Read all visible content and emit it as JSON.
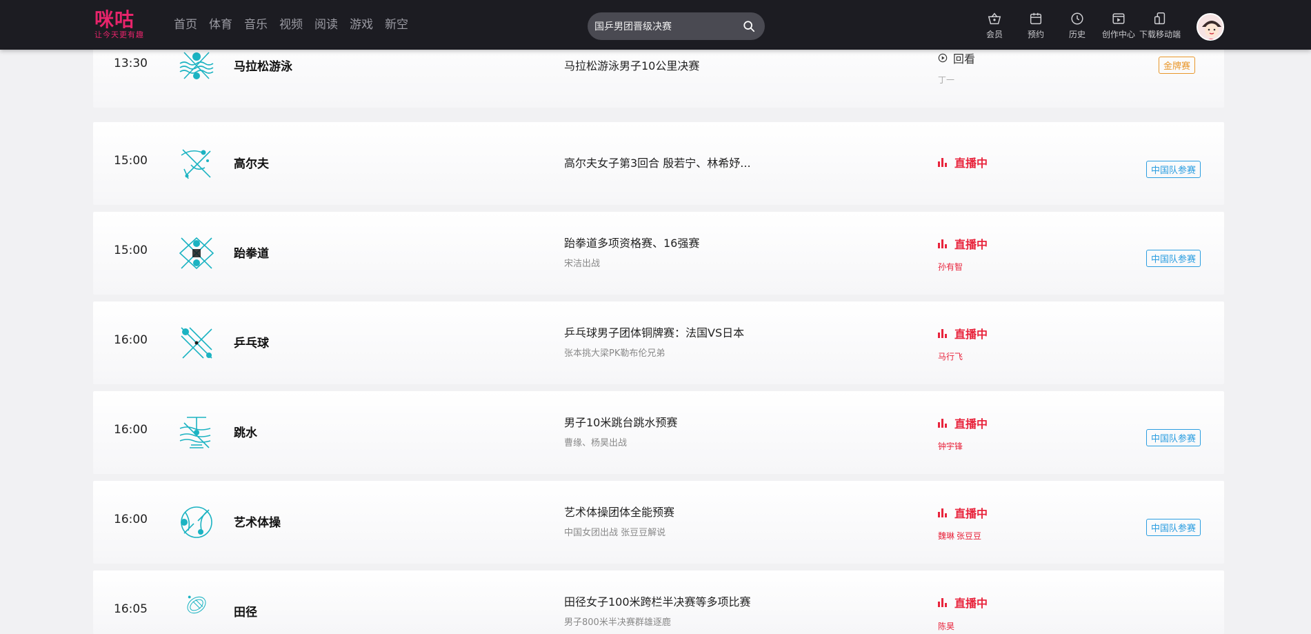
{
  "header": {
    "logo_main": "咪咕",
    "logo_sub": "让今天更有趣",
    "nav": [
      "首页",
      "体育",
      "音乐",
      "视频",
      "阅读",
      "游戏",
      "新空"
    ],
    "search_value": "国乒男团晋级决赛",
    "tools": [
      {
        "label": "会员",
        "icon": "vip-basket-icon"
      },
      {
        "label": "预约",
        "icon": "calendar-icon"
      },
      {
        "label": "历史",
        "icon": "clock-icon"
      },
      {
        "label": "创作中心",
        "icon": "create-video-icon"
      },
      {
        "label": "下载移动端",
        "icon": "mobile-download-icon"
      }
    ],
    "accent_color": "#e8246b"
  },
  "schedule": [
    {
      "time": "13:30",
      "sport": "马拉松游泳",
      "title": "马拉松游泳男子10公里决赛",
      "subtitle": "",
      "status": "回看",
      "status_type": "replay",
      "commentators": [
        "丁一"
      ],
      "badge": "金牌赛",
      "badge_type": "gold"
    },
    {
      "time": "15:00",
      "sport": "高尔夫",
      "title": "高尔夫女子第3回合 殷若宁、林希妤...",
      "subtitle": "",
      "status": "直播中",
      "status_type": "live",
      "commentators": [],
      "badge": "中国队参赛",
      "badge_type": "blue"
    },
    {
      "time": "15:00",
      "sport": "跆拳道",
      "title": "跆拳道多项资格赛、16强赛",
      "subtitle": "宋洁出战",
      "status": "直播中",
      "status_type": "live",
      "commentators": [
        "孙有智"
      ],
      "badge": "中国队参赛",
      "badge_type": "blue"
    },
    {
      "time": "16:00",
      "sport": "乒乓球",
      "title": "乒乓球男子团体铜牌赛：法国VS日本",
      "subtitle": "张本挑大梁PK勒布伦兄弟",
      "status": "直播中",
      "status_type": "live",
      "commentators": [
        "马行飞"
      ],
      "badge": "",
      "badge_type": ""
    },
    {
      "time": "16:00",
      "sport": "跳水",
      "title": "男子10米跳台跳水预赛",
      "subtitle": "曹缘、杨昊出战",
      "status": "直播中",
      "status_type": "live",
      "commentators": [
        "钟宇锋"
      ],
      "badge": "中国队参赛",
      "badge_type": "blue"
    },
    {
      "time": "16:00",
      "sport": "艺术体操",
      "title": "艺术体操团体全能预赛",
      "subtitle": "中国女团出战 张豆豆解说",
      "status": "直播中",
      "status_type": "live",
      "commentators": [
        "魏琳",
        "张豆豆"
      ],
      "badge": "中国队参赛",
      "badge_type": "blue"
    },
    {
      "time": "16:05",
      "sport": "田径",
      "title": "田径女子100米跨栏半决赛等多项比赛",
      "subtitle": "男子800米半决赛群雄逐鹿",
      "status": "直播中",
      "status_type": "live",
      "commentators": [
        "陈昊"
      ],
      "badge": "",
      "badge_type": ""
    }
  ]
}
